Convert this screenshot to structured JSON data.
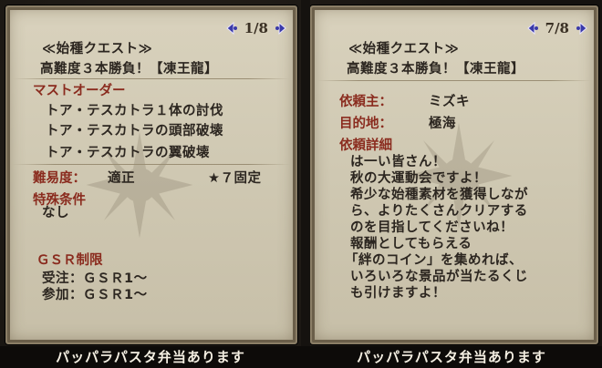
{
  "footer_text": "パッパラパスタ弁当あります",
  "left_panel": {
    "page": "1/8",
    "category": "≪始種クエスト≫",
    "quest_name": "高難度３本勝負！【凍王龍】",
    "must_order_label": "マストオーダー",
    "objectives": [
      "トア・テスカトラ１体の討伐",
      "トア・テスカトラの頭部破壊",
      "トア・テスカトラの翼破壊"
    ],
    "difficulty_label": "難易度：",
    "difficulty_value": "適正",
    "star_value": "★７固定",
    "special_conditions_label": "特殊条件",
    "special_conditions_value": "なし",
    "gsr_label": "ＧＳＲ制限",
    "accept_line": "受注：ＧＳＲ1～",
    "join_line": "参加：ＧＳＲ1～"
  },
  "right_panel": {
    "page": "7/8",
    "category": "≪始種クエスト≫",
    "quest_name": "高難度３本勝負！【凍王龍】",
    "client_label": "依頼主：",
    "client_value": "ミズキ",
    "destination_label": "目的地：",
    "destination_value": "極海",
    "details_label": "依頼詳細",
    "details_lines": [
      "は一い皆さん！",
      "秋の大運動会ですよ！",
      "希少な始種素材を獲得しなが",
      "ら、よりたくさんクリアする",
      "のを目指してくださいね！",
      "報酬としてもらえる",
      "「絆のコイン」を集めれば、",
      "いろいろな景品が当たるくじ",
      "も引けますよ！"
    ]
  }
}
